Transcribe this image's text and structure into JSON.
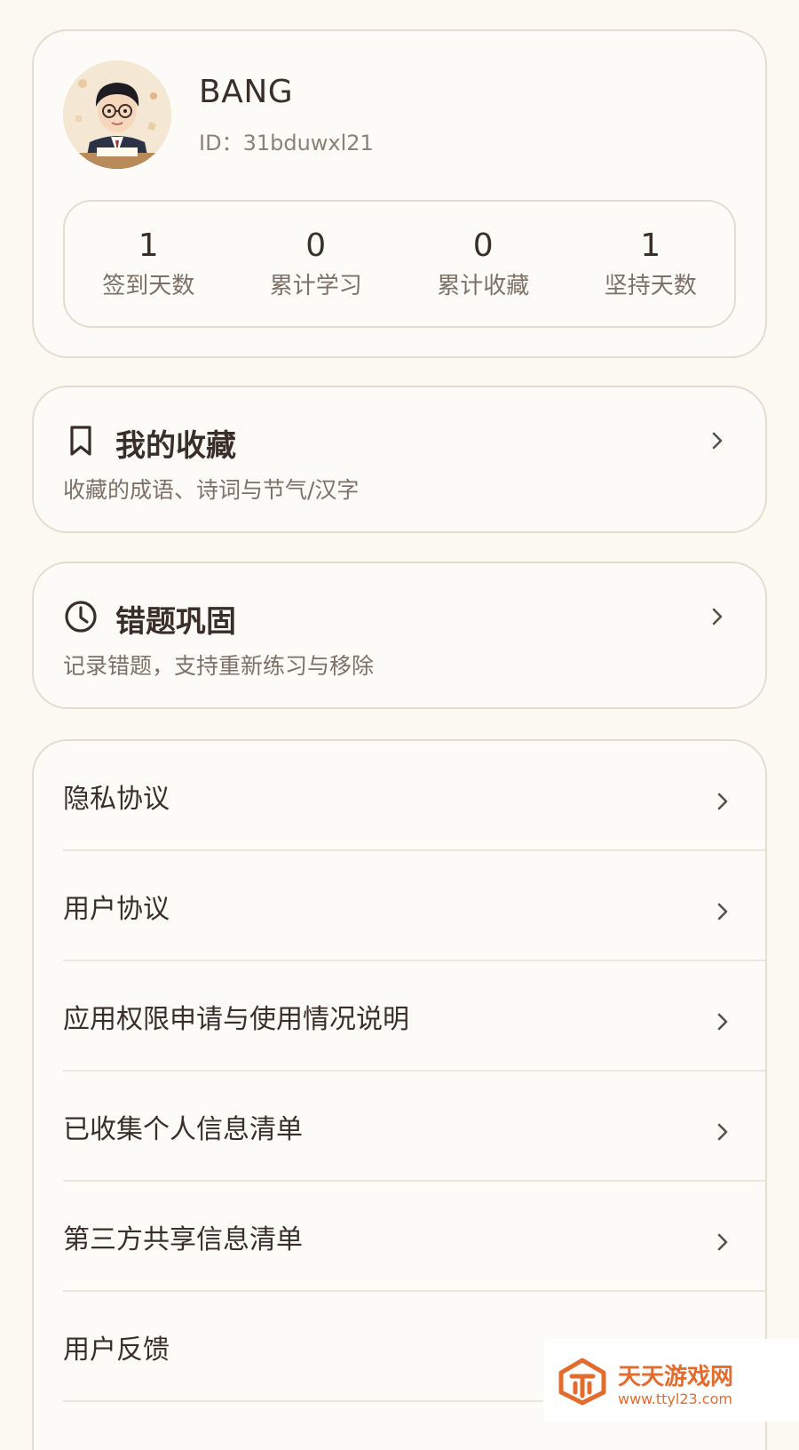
{
  "profile": {
    "username": "BANG",
    "id_label": "ID：",
    "id_value": "31bduwxl21",
    "stats": [
      {
        "value": "1",
        "label": "签到天数"
      },
      {
        "value": "0",
        "label": "累计学习"
      },
      {
        "value": "0",
        "label": "累计收藏"
      },
      {
        "value": "1",
        "label": "坚持天数"
      }
    ]
  },
  "favorites": {
    "icon": "bookmark-icon",
    "title": "我的收藏",
    "subtitle": "收藏的成语、诗词与节气/汉字"
  },
  "mistakes": {
    "icon": "clock-icon",
    "title": "错题巩固",
    "subtitle": "记录错题，支持重新练习与移除"
  },
  "menu": {
    "items": [
      {
        "label": "隐私协议"
      },
      {
        "label": "用户协议"
      },
      {
        "label": "应用权限申请与使用情况说明"
      },
      {
        "label": "已收集个人信息清单"
      },
      {
        "label": "第三方共享信息清单"
      },
      {
        "label": "用户反馈"
      }
    ]
  },
  "watermark": {
    "title": "天天游戏网",
    "url": "www.ttyl23.com"
  },
  "colors": {
    "background": "#fbf9f2",
    "card": "#fcfbf7",
    "border": "#e4ddcf",
    "text_primary": "#3a2f28",
    "text_secondary": "#7d7167",
    "watermark_orange": "#e36b2c"
  }
}
